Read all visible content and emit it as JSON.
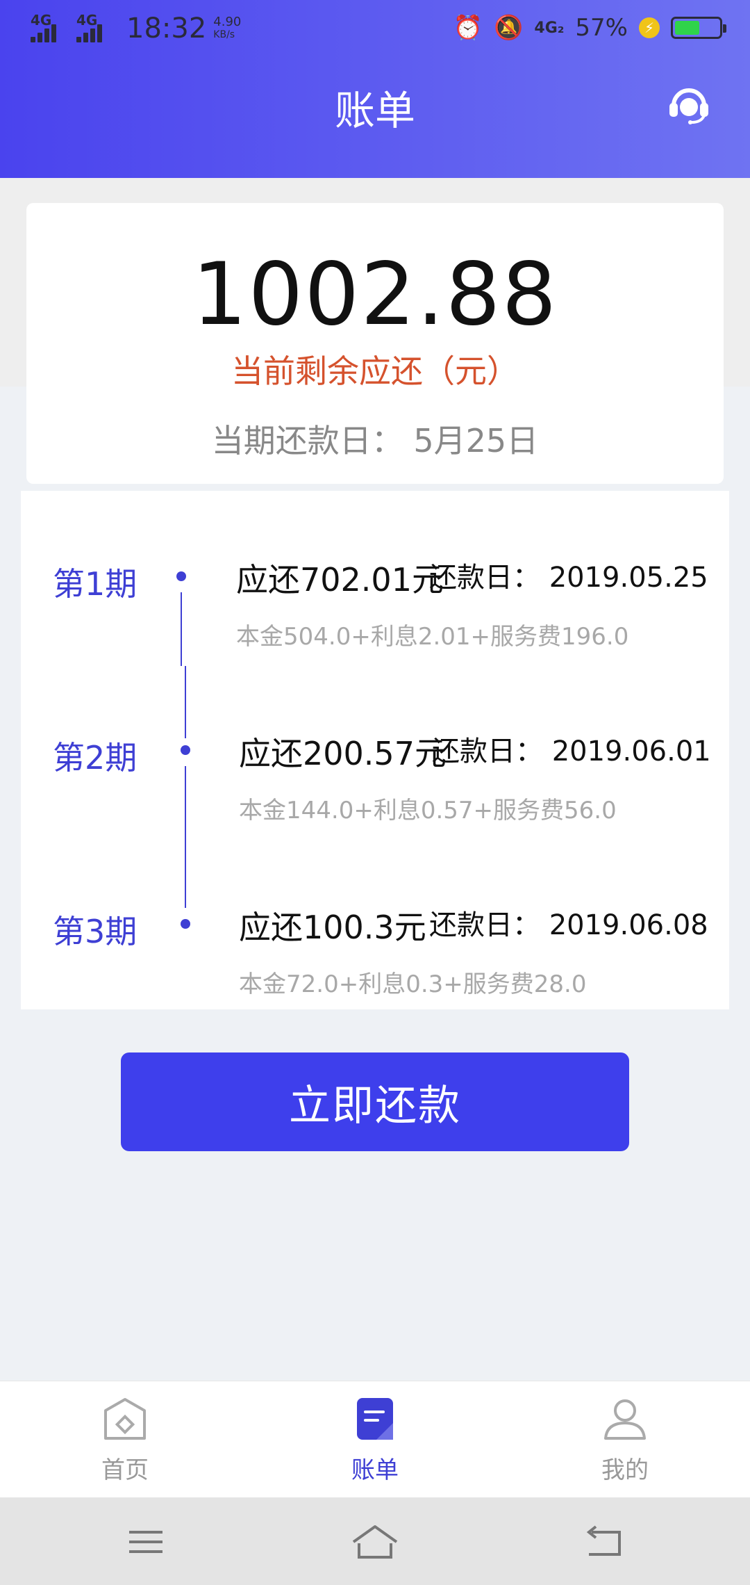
{
  "status_bar": {
    "network_left_1": "4G",
    "network_left_2": "4G",
    "time": "18:32",
    "speed_value": "4.90",
    "speed_unit": "KB/s",
    "network_right": "4G₂",
    "battery": "57%",
    "battery_level": 0.57
  },
  "header": {
    "title": "账单"
  },
  "summary": {
    "amount": "1002.88",
    "amount_label": "当前剩余应还（元）",
    "due_date": "当期还款日：  5月25日"
  },
  "plans": [
    {
      "period": "第1期",
      "amount": "应还702.01元",
      "date": "还款日：  2019.05.25",
      "breakdown": "本金504.0+利息2.01+服务费196.0"
    },
    {
      "period": "第2期",
      "amount": "应还200.57元",
      "date": "还款日：  2019.06.01",
      "breakdown": "本金144.0+利息0.57+服务费56.0"
    },
    {
      "period": "第3期",
      "amount": "应还100.3元",
      "date": "还款日：  2019.06.08",
      "breakdown": "本金72.0+利息0.3+服务费28.0"
    }
  ],
  "actions": {
    "pay_now": "立即还款"
  },
  "tabbar": {
    "items": [
      {
        "label": "首页",
        "icon": "home-icon"
      },
      {
        "label": "账单",
        "icon": "bill-icon",
        "active": true
      },
      {
        "label": "我的",
        "icon": "profile-icon"
      }
    ]
  },
  "colors": {
    "accent": "#3e3fec",
    "header_start": "#4a43ee",
    "header_end": "#6f73f2",
    "amount_label": "#d5522d"
  }
}
